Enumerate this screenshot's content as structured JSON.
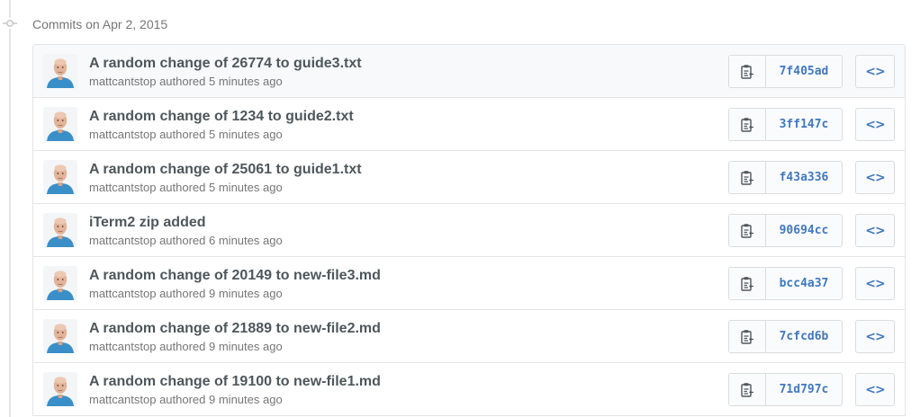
{
  "header": {
    "date_label": "Commits on Apr 2, 2015"
  },
  "icons": {
    "timeline": "git-commit-icon",
    "copy": "clippy-icon",
    "browse": "code-icon",
    "avatar": "user-avatar"
  },
  "colors": {
    "sha_link": "#4078c0",
    "title": "#4e575b",
    "meta": "#767676",
    "border": "#e5e5e5",
    "highlight_row": "#f7f9fb"
  },
  "commits": [
    {
      "title": "A random change of 26774 to guide3.txt",
      "author": "mattcantstop",
      "action": "authored",
      "time": "5 minutes ago",
      "sha": "7f405ad",
      "browse_label": "<>"
    },
    {
      "title": "A random change of 1234 to guide2.txt",
      "author": "mattcantstop",
      "action": "authored",
      "time": "5 minutes ago",
      "sha": "3ff147c",
      "browse_label": "<>"
    },
    {
      "title": "A random change of 25061 to guide1.txt",
      "author": "mattcantstop",
      "action": "authored",
      "time": "5 minutes ago",
      "sha": "f43a336",
      "browse_label": "<>"
    },
    {
      "title": "iTerm2 zip added",
      "author": "mattcantstop",
      "action": "authored",
      "time": "6 minutes ago",
      "sha": "90694cc",
      "browse_label": "<>"
    },
    {
      "title": "A random change of 20149 to new-file3.md",
      "author": "mattcantstop",
      "action": "authored",
      "time": "9 minutes ago",
      "sha": "bcc4a37",
      "browse_label": "<>"
    },
    {
      "title": "A random change of 21889 to new-file2.md",
      "author": "mattcantstop",
      "action": "authored",
      "time": "9 minutes ago",
      "sha": "7cfcd6b",
      "browse_label": "<>"
    },
    {
      "title": "A random change of 19100 to new-file1.md",
      "author": "mattcantstop",
      "action": "authored",
      "time": "9 minutes ago",
      "sha": "71d797c",
      "browse_label": "<>"
    }
  ]
}
